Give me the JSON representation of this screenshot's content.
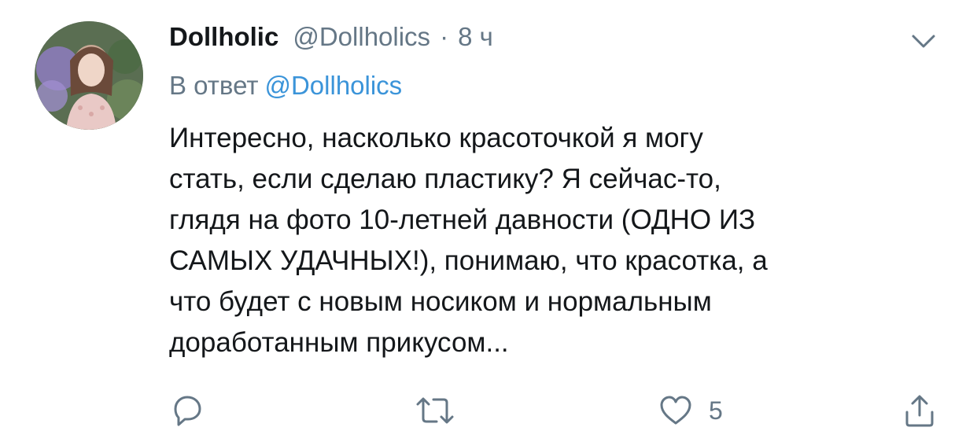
{
  "tweet": {
    "display_name": "Dollholic",
    "handle": "@Dollholics",
    "separator": "·",
    "time": "8 ч",
    "reply_prefix": "В ответ",
    "reply_to": "@Dollholics",
    "text_lines": [
      "Интересно, насколько красоточкой я могу",
      "стать, если сделаю пластику? Я сейчас-то,",
      "глядя на фото 10-летней давности (ОДНО ИЗ",
      "САМЫХ УДАЧНЫХ!), понимаю, что красотка, а",
      "что будет с новым носиком и нормальным",
      "доработанным прикусом..."
    ]
  },
  "actions": {
    "reply_icon": "reply-icon",
    "retweet_icon": "retweet-icon",
    "like_icon": "heart-icon",
    "like_count": "5",
    "share_icon": "share-icon"
  },
  "menu": {
    "icon": "chevron-down-icon"
  },
  "colors": {
    "text": "#14171a",
    "secondary": "#657786",
    "link": "#3b94d9",
    "icon": "#657786"
  }
}
